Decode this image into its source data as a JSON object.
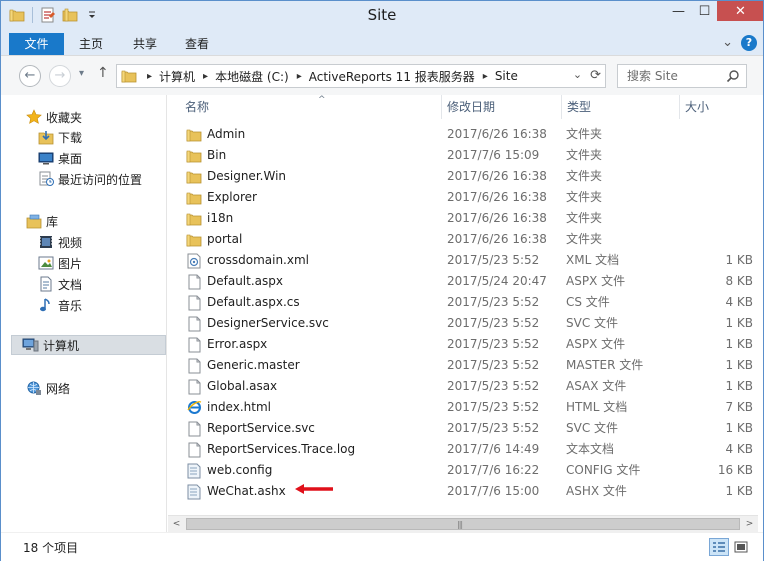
{
  "window": {
    "title": "Site",
    "controls": {
      "minimize": "—",
      "maximize": "☐",
      "close": "✕"
    }
  },
  "quick_access": {
    "icons": [
      "folder-icon",
      "properties-icon",
      "new-folder-icon",
      "customize-dropdown-icon"
    ]
  },
  "ribbon": {
    "tabs": [
      {
        "label": "文件",
        "active": true
      },
      {
        "label": "主页",
        "active": false
      },
      {
        "label": "共享",
        "active": false
      },
      {
        "label": "查看",
        "active": false
      }
    ],
    "expand_glyph": "⌄",
    "help_glyph": "?"
  },
  "navigation": {
    "back_glyph": "←",
    "forward_glyph": "→",
    "recent_glyph": "▾",
    "up_glyph": "↑",
    "breadcrumbs": [
      "计算机",
      "本地磁盘 (C:)",
      "ActiveReports 11 报表服务器",
      "Site"
    ],
    "crumb_separator": "▸",
    "refresh_glyph": "⟳",
    "history_glyph": "⌄",
    "search_placeholder": "搜索 Site"
  },
  "sidebar": {
    "items": [
      {
        "label": "收藏夹",
        "icon": "star-icon",
        "level": 0
      },
      {
        "label": "下载",
        "icon": "download-icon",
        "level": 1
      },
      {
        "label": "桌面",
        "icon": "desktop-icon",
        "level": 1
      },
      {
        "label": "最近访问的位置",
        "icon": "recent-places-icon",
        "level": 1
      },
      {
        "label": "库",
        "icon": "library-icon",
        "level": 0
      },
      {
        "label": "视频",
        "icon": "video-icon",
        "level": 1
      },
      {
        "label": "图片",
        "icon": "pictures-icon",
        "level": 1
      },
      {
        "label": "文档",
        "icon": "documents-icon",
        "level": 1
      },
      {
        "label": "音乐",
        "icon": "music-icon",
        "level": 1
      },
      {
        "label": "计算机",
        "icon": "computer-icon",
        "level": 0,
        "selected": true
      },
      {
        "label": "网络",
        "icon": "network-icon",
        "level": 0
      }
    ]
  },
  "file_list": {
    "columns": {
      "name": "名称",
      "date": "修改日期",
      "type": "类型",
      "size": "大小"
    },
    "sort_glyph": "^",
    "rows": [
      {
        "name": "Admin",
        "date": "2017/6/26 16:38",
        "type": "文件夹",
        "size": "",
        "icon": "folder-icon"
      },
      {
        "name": "Bin",
        "date": "2017/7/6 15:09",
        "type": "文件夹",
        "size": "",
        "icon": "folder-icon"
      },
      {
        "name": "Designer.Win",
        "date": "2017/6/26 16:38",
        "type": "文件夹",
        "size": "",
        "icon": "folder-icon"
      },
      {
        "name": "Explorer",
        "date": "2017/6/26 16:38",
        "type": "文件夹",
        "size": "",
        "icon": "folder-icon"
      },
      {
        "name": "i18n",
        "date": "2017/6/26 16:38",
        "type": "文件夹",
        "size": "",
        "icon": "folder-icon"
      },
      {
        "name": "portal",
        "date": "2017/6/26 16:38",
        "type": "文件夹",
        "size": "",
        "icon": "folder-icon"
      },
      {
        "name": "crossdomain.xml",
        "date": "2017/5/23 5:52",
        "type": "XML 文档",
        "size": "1 KB",
        "icon": "xml-file-icon"
      },
      {
        "name": "Default.aspx",
        "date": "2017/5/24 20:47",
        "type": "ASPX 文件",
        "size": "8 KB",
        "icon": "file-icon"
      },
      {
        "name": "Default.aspx.cs",
        "date": "2017/5/23 5:52",
        "type": "CS 文件",
        "size": "4 KB",
        "icon": "file-icon"
      },
      {
        "name": "DesignerService.svc",
        "date": "2017/5/23 5:52",
        "type": "SVC 文件",
        "size": "1 KB",
        "icon": "file-icon"
      },
      {
        "name": "Error.aspx",
        "date": "2017/5/23 5:52",
        "type": "ASPX 文件",
        "size": "1 KB",
        "icon": "file-icon"
      },
      {
        "name": "Generic.master",
        "date": "2017/5/23 5:52",
        "type": "MASTER 文件",
        "size": "1 KB",
        "icon": "file-icon"
      },
      {
        "name": "Global.asax",
        "date": "2017/5/23 5:52",
        "type": "ASAX 文件",
        "size": "1 KB",
        "icon": "file-icon"
      },
      {
        "name": "index.html",
        "date": "2017/5/23 5:52",
        "type": "HTML 文档",
        "size": "7 KB",
        "icon": "ie-html-icon"
      },
      {
        "name": "ReportService.svc",
        "date": "2017/5/23 5:52",
        "type": "SVC 文件",
        "size": "1 KB",
        "icon": "file-icon"
      },
      {
        "name": "ReportServices.Trace.log",
        "date": "2017/7/6 14:49",
        "type": "文本文档",
        "size": "4 KB",
        "icon": "file-icon"
      },
      {
        "name": "web.config",
        "date": "2017/7/6 16:22",
        "type": "CONFIG 文件",
        "size": "16 KB",
        "icon": "config-file-icon"
      },
      {
        "name": "WeChat.ashx",
        "date": "2017/7/6 15:00",
        "type": "ASHX 文件",
        "size": "1 KB",
        "icon": "config-file-icon",
        "annotated": true
      }
    ]
  },
  "scrollbar": {
    "left_glyph": "<",
    "right_glyph": ">",
    "grip_glyph": "|||"
  },
  "status": {
    "item_count": "18 个项目"
  },
  "colors": {
    "accent": "#1979ca",
    "frame": "#dfeaf7",
    "folder": "#e8c25a",
    "annotation_arrow": "#e0101a"
  }
}
